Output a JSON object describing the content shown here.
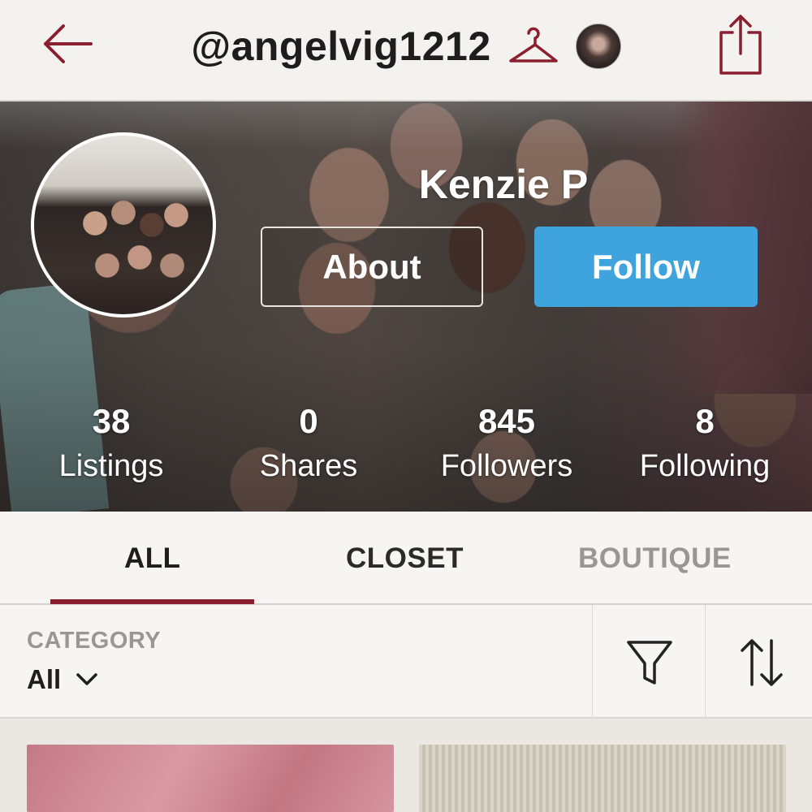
{
  "header": {
    "username": "@angelvig1212",
    "back_icon": "back-arrow-icon",
    "hanger_icon": "hanger-icon",
    "share_icon": "share-icon"
  },
  "profile": {
    "name": "Kenzie P",
    "about_label": "About",
    "follow_label": "Follow",
    "stats": [
      {
        "value": "38",
        "label": "Listings"
      },
      {
        "value": "0",
        "label": "Shares"
      },
      {
        "value": "845",
        "label": "Followers"
      },
      {
        "value": "8",
        "label": "Following"
      }
    ]
  },
  "tabs": [
    {
      "label": "ALL",
      "active": true
    },
    {
      "label": "CLOSET",
      "active": false
    },
    {
      "label": "BOUTIQUE",
      "active": false
    }
  ],
  "filter": {
    "category_label": "CATEGORY",
    "category_value": "All"
  },
  "colors": {
    "accent": "#8a1f2f",
    "follow": "#3fa3dd",
    "tab_active": "#1e1e1e",
    "tab_inactive": "#9a9694"
  }
}
